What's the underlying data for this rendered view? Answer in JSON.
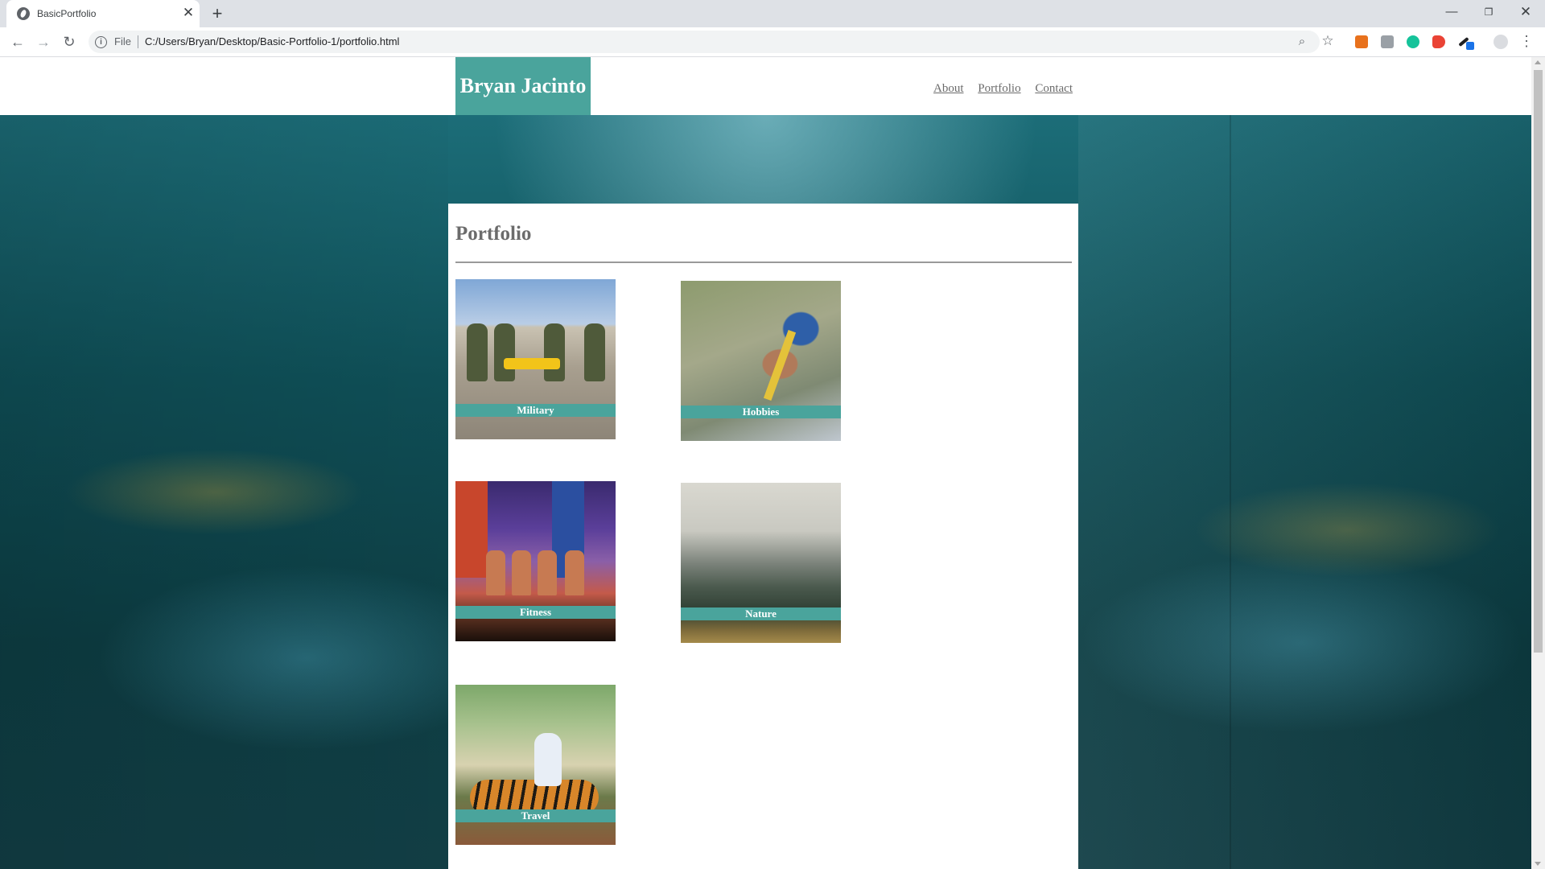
{
  "browser": {
    "tab_title": "BasicPortfolio",
    "url_scheme": "File",
    "url": "C:/Users/Bryan/Desktop/Basic-Portfolio-1/portfolio.html"
  },
  "site": {
    "brand": "Bryan Jacinto",
    "nav": [
      "About",
      "Portfolio",
      "Contact"
    ]
  },
  "page": {
    "title": "Portfolio",
    "items": [
      {
        "caption": "Military"
      },
      {
        "caption": "Hobbies"
      },
      {
        "caption": "Fitness"
      },
      {
        "caption": "Nature"
      },
      {
        "caption": "Travel"
      }
    ]
  },
  "colors": {
    "accent": "#4aa49c",
    "heading": "#6b6b6b"
  },
  "icons": [
    "globe-icon",
    "close-icon",
    "plus-icon",
    "back-arrow-icon",
    "forward-arrow-icon",
    "reload-icon",
    "info-icon",
    "zoom-icon",
    "star-icon",
    "kebab-menu-icon"
  ]
}
